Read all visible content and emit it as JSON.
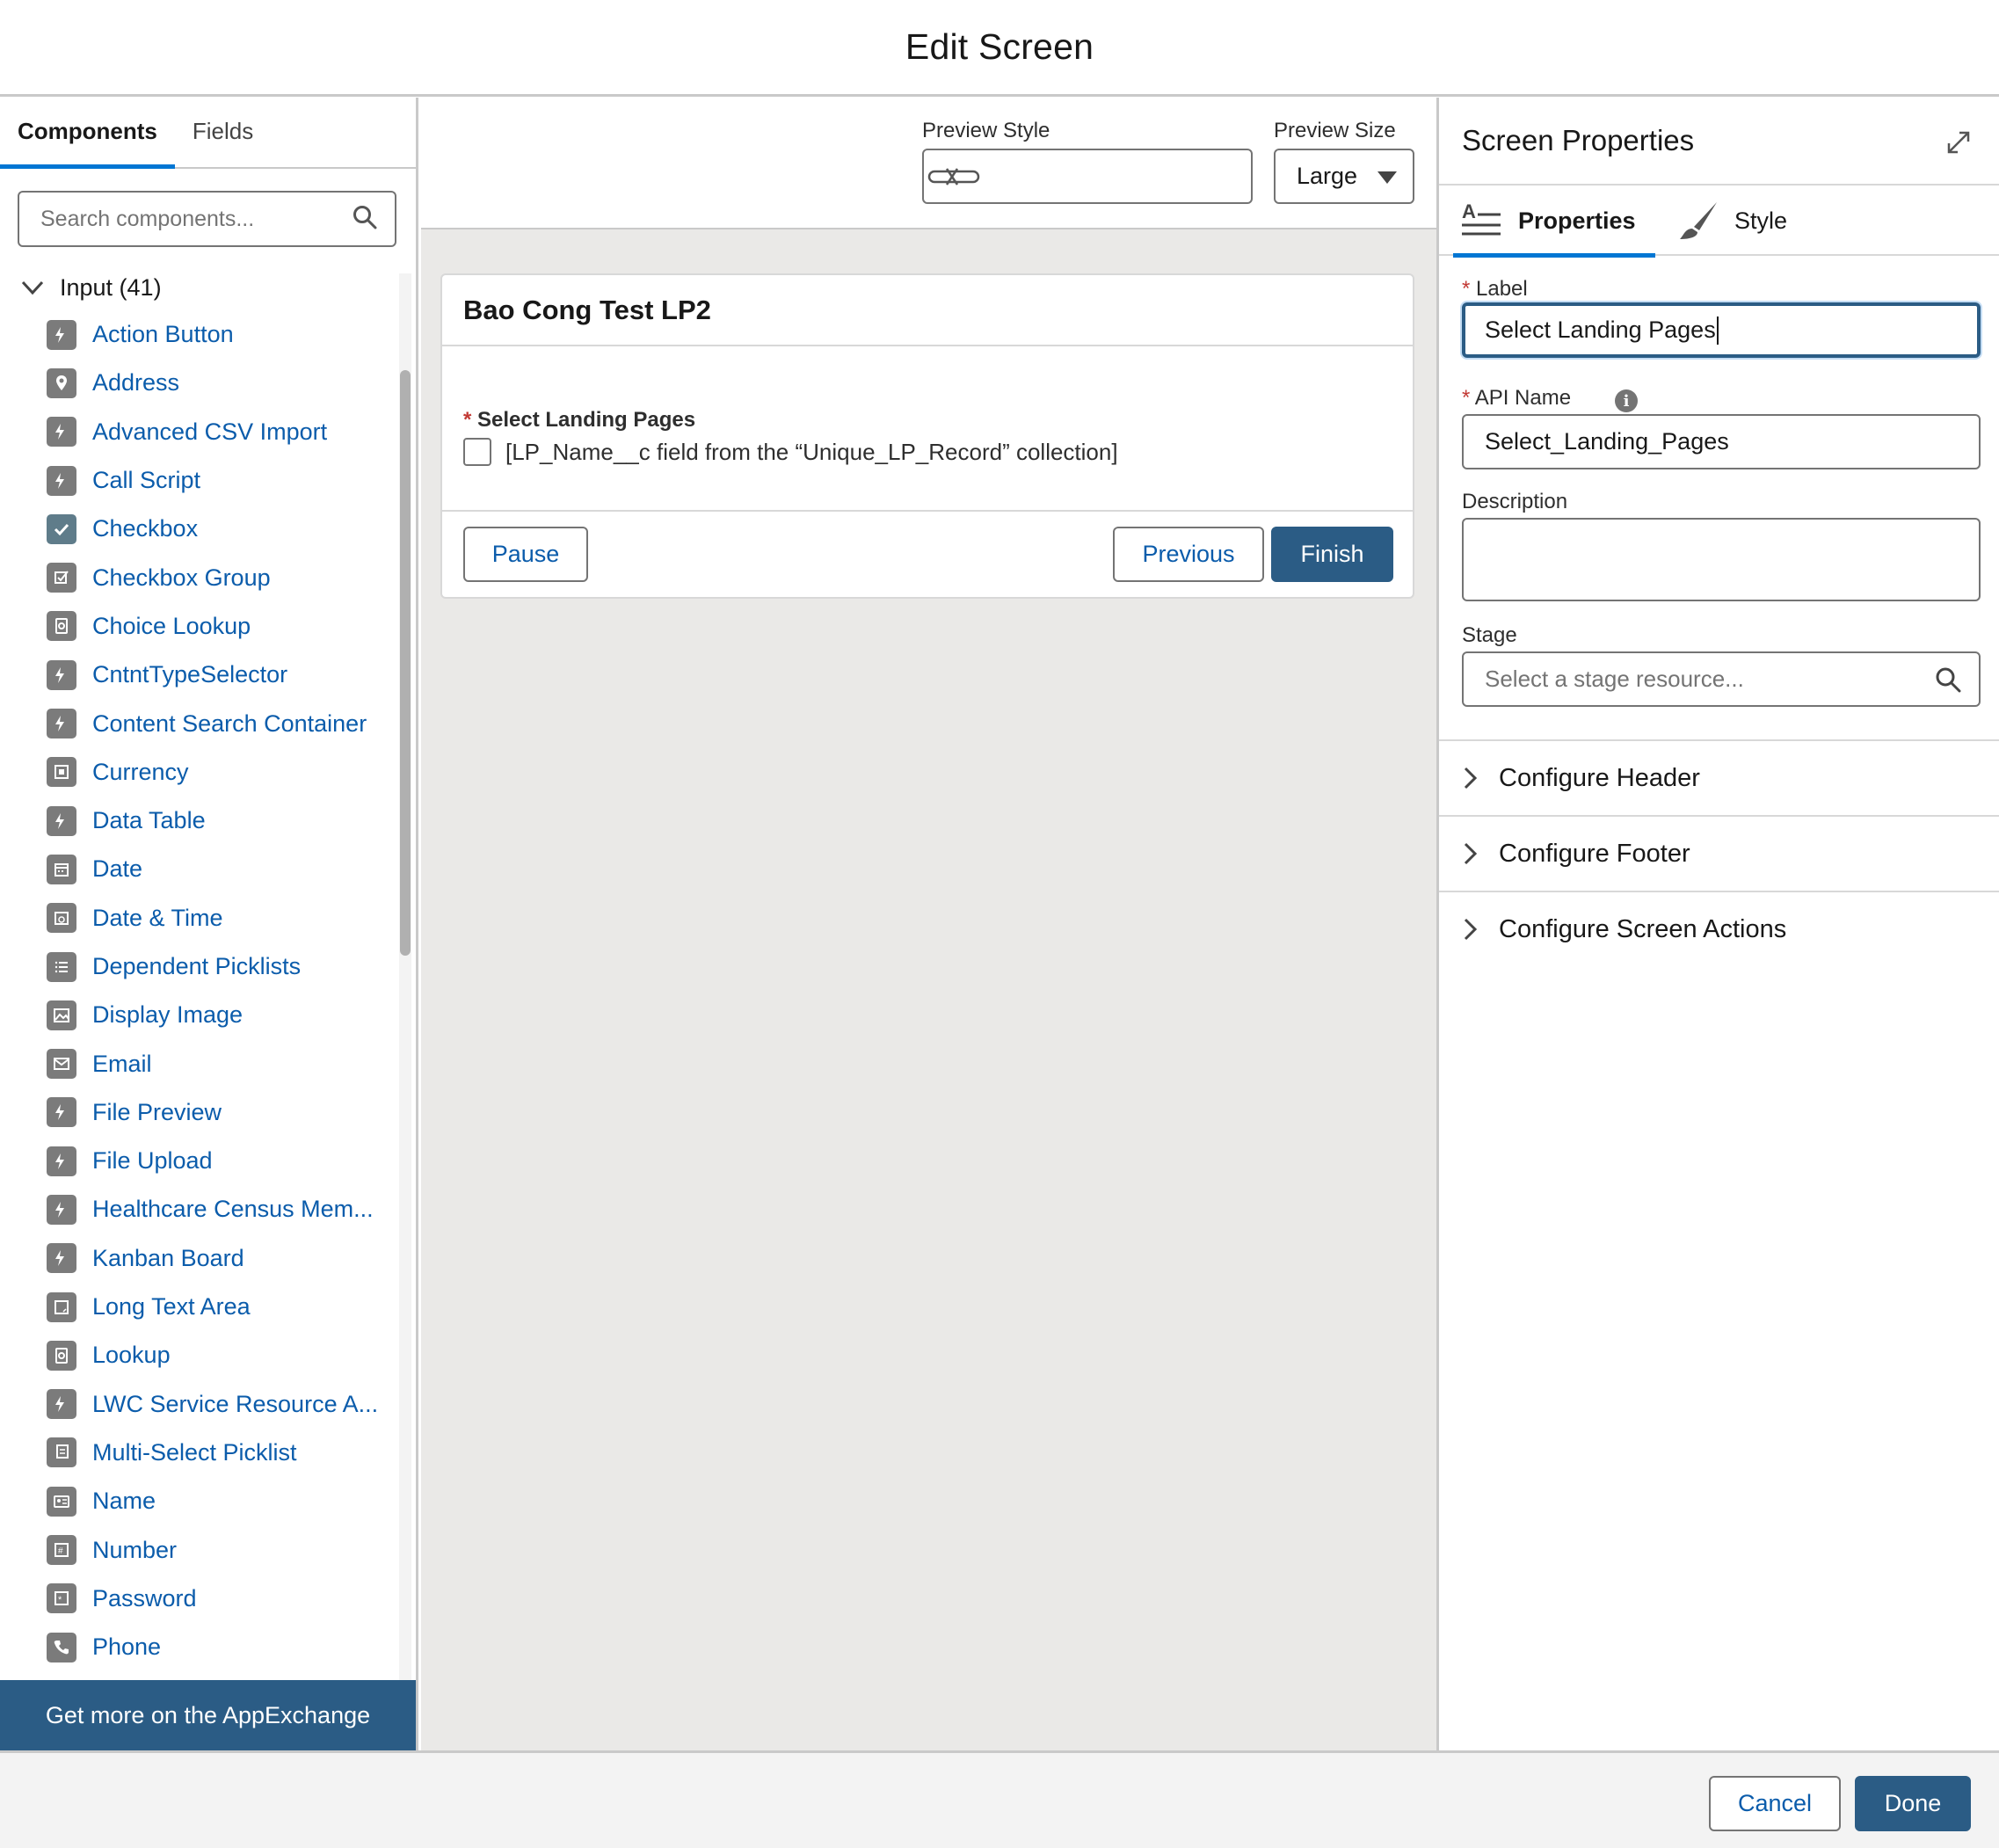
{
  "header": {
    "title": "Edit Screen"
  },
  "left_panel": {
    "tabs": [
      {
        "label": "Components"
      },
      {
        "label": "Fields"
      }
    ],
    "search": {
      "placeholder": "Search components..."
    },
    "group": {
      "label": "Input (41)"
    },
    "items": [
      {
        "label": "Action Button",
        "icon": "bolt-icon"
      },
      {
        "label": "Address",
        "icon": "location-icon"
      },
      {
        "label": "Advanced CSV Import",
        "icon": "bolt-icon"
      },
      {
        "label": "Call Script",
        "icon": "bolt-icon"
      },
      {
        "label": "Checkbox",
        "icon": "check-icon"
      },
      {
        "label": "Checkbox Group",
        "icon": "checkbox-group-icon"
      },
      {
        "label": "Choice Lookup",
        "icon": "lookup-icon"
      },
      {
        "label": "CntntTypeSelector",
        "icon": "bolt-icon"
      },
      {
        "label": "Content Search Container",
        "icon": "bolt-icon"
      },
      {
        "label": "Currency",
        "icon": "currency-icon"
      },
      {
        "label": "Data Table",
        "icon": "bolt-icon"
      },
      {
        "label": "Date",
        "icon": "calendar-icon"
      },
      {
        "label": "Date & Time",
        "icon": "datetime-icon"
      },
      {
        "label": "Dependent Picklists",
        "icon": "list-icon"
      },
      {
        "label": "Display Image",
        "icon": "image-icon"
      },
      {
        "label": "Email",
        "icon": "email-icon"
      },
      {
        "label": "File Preview",
        "icon": "bolt-icon"
      },
      {
        "label": "File Upload",
        "icon": "bolt-icon"
      },
      {
        "label": "Healthcare Census Mem...",
        "icon": "bolt-icon"
      },
      {
        "label": "Kanban Board",
        "icon": "bolt-icon"
      },
      {
        "label": "Long Text Area",
        "icon": "textarea-icon"
      },
      {
        "label": "Lookup",
        "icon": "lookup-icon"
      },
      {
        "label": "LWC Service Resource A...",
        "icon": "bolt-icon"
      },
      {
        "label": "Multi-Select Picklist",
        "icon": "multi-picklist-icon"
      },
      {
        "label": "Name",
        "icon": "name-card-icon"
      },
      {
        "label": "Number",
        "icon": "number-icon"
      },
      {
        "label": "Password",
        "icon": "password-icon"
      },
      {
        "label": "Phone",
        "icon": "phone-icon"
      }
    ],
    "appexchange_label": "Get more on the AppExchange"
  },
  "center": {
    "preview_style": {
      "label": "Preview Style",
      "value": ""
    },
    "preview_size": {
      "label": "Preview Size",
      "value": "Large"
    },
    "screen": {
      "title": "Bao Cong Test LP2",
      "field_label": "Select Landing Pages",
      "required_marker": "*",
      "checkbox_text": "[LP_Name__c field from the “Unique_LP_Record” collection]",
      "checked": false,
      "buttons": {
        "pause": "Pause",
        "previous": "Previous",
        "finish": "Finish"
      }
    }
  },
  "right_panel": {
    "title": "Screen Properties",
    "tabs": [
      {
        "label": "Properties"
      },
      {
        "label": "Style"
      }
    ],
    "label_field": {
      "label": "Label",
      "value": "Select Landing Pages"
    },
    "api_name_field": {
      "label": "API Name",
      "value": "Select_Landing_Pages"
    },
    "description_field": {
      "label": "Description",
      "value": ""
    },
    "stage_field": {
      "label": "Stage",
      "placeholder": "Select a stage resource..."
    },
    "sections": [
      {
        "label": "Configure Header"
      },
      {
        "label": "Configure Footer"
      },
      {
        "label": "Configure Screen Actions"
      }
    ]
  },
  "footer": {
    "cancel_label": "Cancel",
    "done_label": "Done"
  },
  "colors": {
    "brand": "#2b5c85",
    "link": "#0b5cab",
    "active_tab": "#0176d3",
    "required": "#c23934",
    "canvas": "#eae9e7"
  }
}
